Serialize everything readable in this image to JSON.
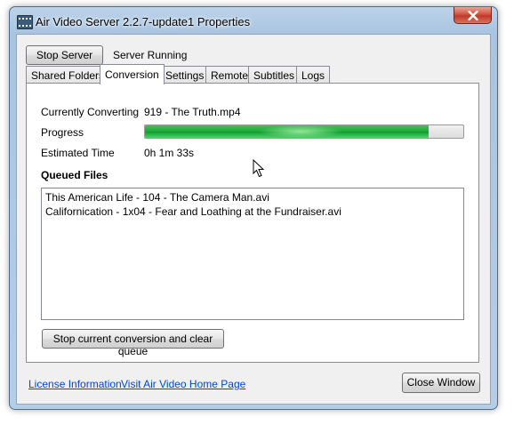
{
  "window": {
    "title": "Air Video Server 2.2.7-update1 Properties",
    "icon": "film-strip-icon",
    "close_icon": "close-icon"
  },
  "server": {
    "stop_button_label": "Stop Server",
    "status_text": "Server Running"
  },
  "tabs": [
    {
      "label": "Shared Folders",
      "active": false
    },
    {
      "label": "Conversion",
      "active": true
    },
    {
      "label": "Settings",
      "active": false
    },
    {
      "label": "Remote",
      "active": false
    },
    {
      "label": "Subtitles",
      "active": false
    },
    {
      "label": "Logs",
      "active": false
    }
  ],
  "conversion": {
    "currently_converting_label": "Currently Converting",
    "currently_converting_value": "919 - The Truth.mp4",
    "progress_label": "Progress",
    "progress_fraction": 0.89,
    "estimated_time_label": "Estimated Time",
    "estimated_time_value": "0h 1m 33s",
    "queued_files_heading": "Queued Files",
    "queued_files": [
      "This American Life - 104 - The Camera Man.avi",
      "Californication - 1x04 - Fear and Loathing at the Fundraiser.avi"
    ],
    "stop_clear_button_label": "Stop current conversion and clear queue"
  },
  "footer": {
    "license_link": "License Information",
    "homepage_link": "Visit Air Video Home Page",
    "close_button_label": "Close Window"
  },
  "colors": {
    "progress_green": "#1fa63a",
    "link_blue": "#0046d5"
  }
}
